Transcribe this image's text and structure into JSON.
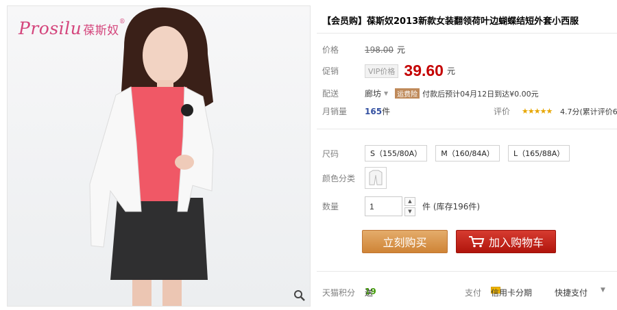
{
  "product": {
    "title": "【会员购】葆斯奴2013新款女装翻领荷叶边蝴蝶结短外套小西服",
    "brand_logo": "Prosilu",
    "brand_cn": "葆斯奴"
  },
  "price": {
    "label": "价格",
    "original": "198.00",
    "unit": "元"
  },
  "promo": {
    "label": "促销",
    "vip_tag": "VIP价格",
    "price": "39.60",
    "unit": "元"
  },
  "shipping": {
    "label": "配送",
    "location": "廊坊",
    "tag": "运费险",
    "text": "付款后预计04月12日到达¥0.00元"
  },
  "sales": {
    "label": "月销量",
    "count": "165",
    "unit": "件",
    "rating_label": "评价",
    "stars": "★★★★★",
    "score": "4.7分(累计评价6"
  },
  "size": {
    "label": "尺码",
    "options": [
      "S（155/80A）",
      "M（160/84A）",
      "L（165/88A）"
    ]
  },
  "color": {
    "label": "颜色分类"
  },
  "quantity": {
    "label": "数量",
    "value": "1",
    "stock": "件 (库存196件)"
  },
  "buttons": {
    "buy": "立刻购买",
    "cart": "加入购物车"
  },
  "footer": {
    "points_label": "天猫积分",
    "points_prefix": "送",
    "points": "19",
    "pay_label": "支付",
    "card_pay": "信用卡分期",
    "quick_pay": "快捷支付"
  },
  "colors": {
    "price_red": "#c40000",
    "buy_orange": "#d58b3e",
    "cart_red": "#c3241a",
    "brand_pink": "#d4457c"
  }
}
